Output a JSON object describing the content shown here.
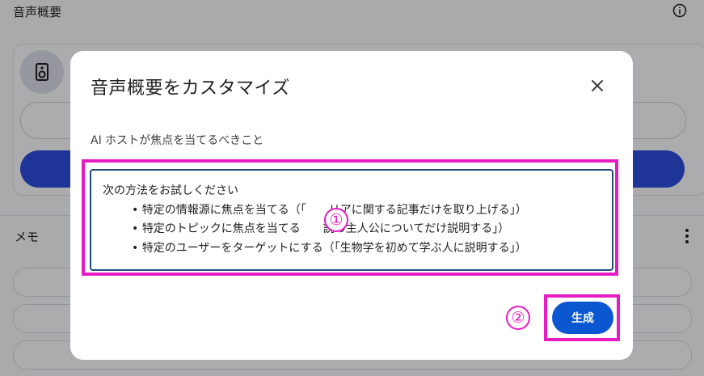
{
  "background": {
    "section_title": "音声概要",
    "memo_label": "メモ"
  },
  "dialog": {
    "title": "音声概要をカスタマイズ",
    "field_label": "AI ホストが焦点を当てるべきこと",
    "prompt_lines": [
      "次の方法をお試しください",
      "• 特定の情報源に焦点を当てる（「　　リアに関する記事だけを取り上げる」）",
      "• 特定のトピックに焦点を当てる　　説の主人公についてだけ説明する」）",
      "• 特定のユーザーをターゲットにする（「生物学を初めて学ぶ人に説明する」）"
    ],
    "generate_label": "生成"
  },
  "annotations": {
    "marker_1": "①",
    "marker_2": "②",
    "highlight_color": "#e61bc4"
  },
  "colors": {
    "accent_blue": "#0b57d0",
    "background_pill_blue": "#2b4bd8",
    "prompt_border": "#1e4a7a"
  },
  "icons": {
    "info": "info-icon",
    "speaker": "speaker-icon",
    "menu": "kebab-menu-icon",
    "close": "close-icon"
  }
}
